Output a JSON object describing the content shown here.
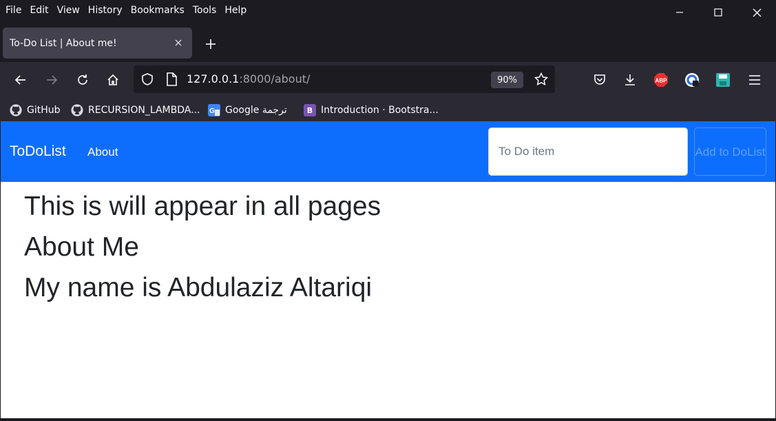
{
  "menu": {
    "items": [
      {
        "label": "File"
      },
      {
        "label": "Edit"
      },
      {
        "label": "View"
      },
      {
        "label": "History"
      },
      {
        "label": "Bookmarks"
      },
      {
        "label": "Tools"
      },
      {
        "label": "Help"
      }
    ]
  },
  "tab": {
    "title": "To-Do List | About me!"
  },
  "urlbar": {
    "host": "127.0.0.1",
    "path": ":8000/about/",
    "zoom": "90%"
  },
  "bookmarks": [
    {
      "label": "GitHub"
    },
    {
      "label": "RECURSION_LAMBDA..."
    },
    {
      "label": "Google ترجمة"
    },
    {
      "label": "Introduction · Bootstra..."
    }
  ],
  "site": {
    "brand": "ToDoList",
    "nav_about": "About",
    "input_placeholder": "To Do item",
    "add_button": "Add to DoList",
    "lines": [
      "This is will appear in all pages",
      "About Me",
      "My name is Abdulaziz Altariqi"
    ]
  },
  "colors": {
    "navbar": "#0d6efd",
    "browser_dark": "#1c1b22",
    "toolbar": "#2b2a33"
  }
}
